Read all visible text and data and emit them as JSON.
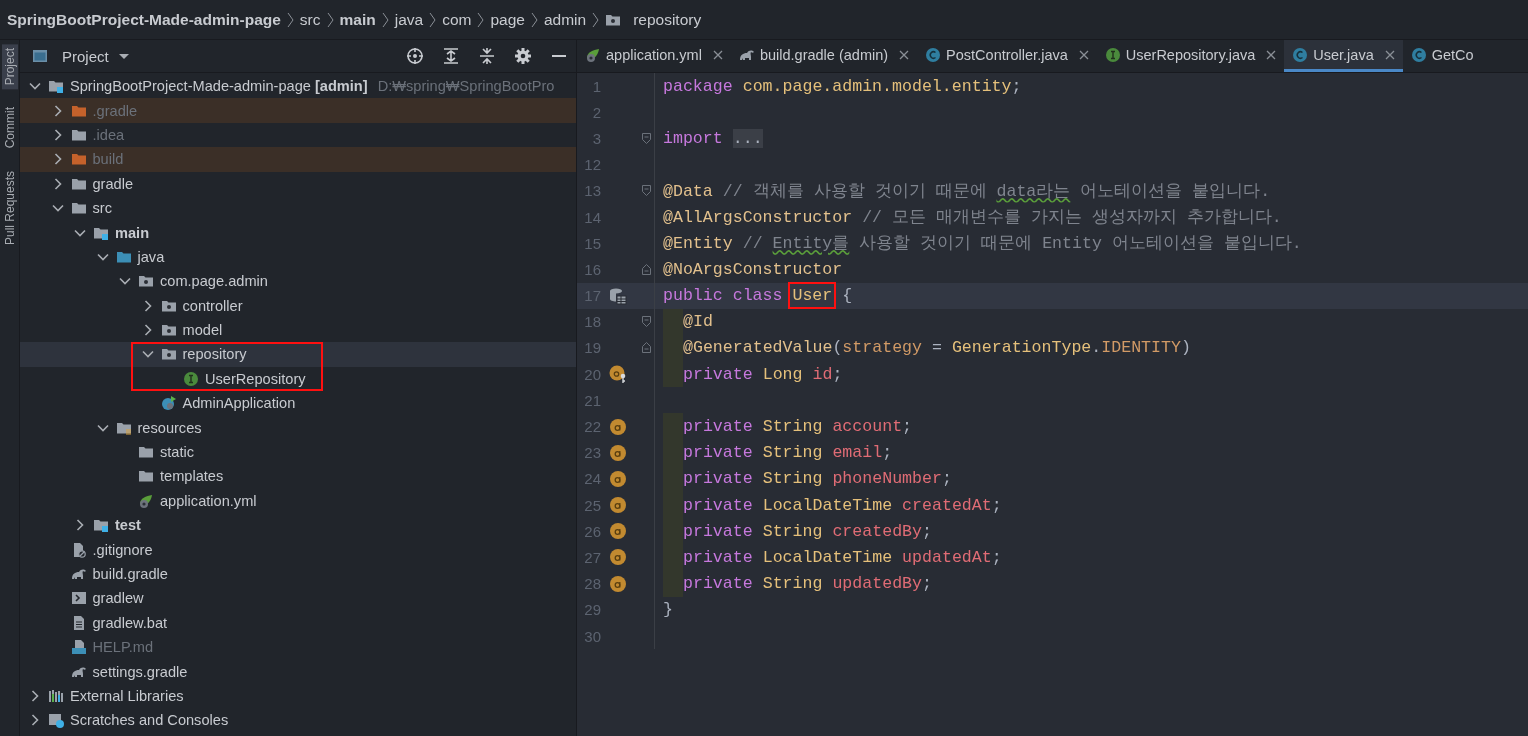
{
  "breadcrumbs": [
    {
      "label": "SpringBootProject-Made-admin-page",
      "kind": "bold"
    },
    {
      "label": "src",
      "kind": "plain"
    },
    {
      "label": "main",
      "kind": "bold"
    },
    {
      "label": "java",
      "kind": "plain"
    },
    {
      "label": "com",
      "kind": "plain"
    },
    {
      "label": "page",
      "kind": "plain"
    },
    {
      "label": "admin",
      "kind": "plain"
    },
    {
      "label": "repository",
      "kind": "folder"
    }
  ],
  "tool_strip": [
    {
      "label": "Project",
      "selected": true
    },
    {
      "label": "Commit",
      "selected": false
    },
    {
      "label": "Pull Requests",
      "selected": false
    }
  ],
  "project_panel": {
    "title": "Project",
    "tree": [
      {
        "label": "SpringBootProject-Made-admin-page",
        "module": "[admin]",
        "path": "D:₩spring₩SpringBootPro",
        "kind": "module",
        "excluded": false,
        "dimmed": false,
        "selected": false,
        "expanded": true,
        "children": [
          {
            "label": ".gradle",
            "kind": "folder-excluded",
            "excluded": true,
            "dimmed": true,
            "selected": false,
            "expanded": false
          },
          {
            "label": ".idea",
            "kind": "folder",
            "excluded": false,
            "dimmed": true,
            "selected": false,
            "expanded": false
          },
          {
            "label": "build",
            "kind": "folder-excluded",
            "excluded": true,
            "dimmed": true,
            "selected": false,
            "expanded": false
          },
          {
            "label": "gradle",
            "kind": "folder",
            "excluded": false,
            "dimmed": false,
            "selected": false,
            "expanded": false
          },
          {
            "label": "src",
            "kind": "folder",
            "excluded": false,
            "dimmed": false,
            "selected": false,
            "expanded": true,
            "children": [
              {
                "label": "main",
                "kind": "source-root",
                "excluded": false,
                "dimmed": false,
                "selected": false,
                "expanded": true,
                "children": [
                  {
                    "label": "java",
                    "kind": "java-root",
                    "excluded": false,
                    "dimmed": false,
                    "selected": false,
                    "expanded": true,
                    "children": [
                      {
                        "label": "com.page.admin",
                        "kind": "package",
                        "excluded": false,
                        "dimmed": false,
                        "selected": false,
                        "expanded": true,
                        "children": [
                          {
                            "label": "controller",
                            "kind": "package",
                            "excluded": false,
                            "dimmed": false,
                            "selected": false,
                            "expanded": false
                          },
                          {
                            "label": "model",
                            "kind": "package",
                            "excluded": false,
                            "dimmed": false,
                            "selected": false,
                            "expanded": false
                          },
                          {
                            "label": "repository",
                            "kind": "package",
                            "excluded": false,
                            "dimmed": false,
                            "selected": true,
                            "boxed": true,
                            "expanded": true,
                            "children": [
                              {
                                "label": "UserRepository",
                                "kind": "interface",
                                "excluded": false,
                                "dimmed": false,
                                "selected": false
                              }
                            ]
                          },
                          {
                            "label": "AdminApplication",
                            "kind": "spring-app",
                            "excluded": false,
                            "dimmed": false,
                            "selected": false
                          }
                        ]
                      }
                    ]
                  },
                  {
                    "label": "resources",
                    "kind": "resources-root",
                    "excluded": false,
                    "dimmed": false,
                    "selected": false,
                    "expanded": true,
                    "children": [
                      {
                        "label": "static",
                        "kind": "folder",
                        "excluded": false,
                        "dimmed": false,
                        "selected": false
                      },
                      {
                        "label": "templates",
                        "kind": "folder",
                        "excluded": false,
                        "dimmed": false,
                        "selected": false
                      },
                      {
                        "label": "application.yml",
                        "kind": "spring-config",
                        "excluded": false,
                        "dimmed": false,
                        "selected": false
                      }
                    ]
                  }
                ]
              },
              {
                "label": "test",
                "kind": "source-root",
                "excluded": false,
                "dimmed": false,
                "selected": false,
                "expanded": false
              }
            ]
          },
          {
            "label": ".gitignore",
            "kind": "gitignore",
            "excluded": false,
            "dimmed": false,
            "selected": false
          },
          {
            "label": "build.gradle",
            "kind": "gradle",
            "excluded": false,
            "dimmed": false,
            "selected": false
          },
          {
            "label": "gradlew",
            "kind": "script",
            "excluded": false,
            "dimmed": false,
            "selected": false
          },
          {
            "label": "gradlew.bat",
            "kind": "text-file",
            "excluded": false,
            "dimmed": false,
            "selected": false
          },
          {
            "label": "HELP.md",
            "kind": "markdown",
            "excluded": false,
            "dimmed": true,
            "selected": false
          },
          {
            "label": "settings.gradle",
            "kind": "gradle",
            "excluded": false,
            "dimmed": false,
            "selected": false
          }
        ]
      },
      {
        "label": "External Libraries",
        "kind": "library",
        "excluded": false,
        "dimmed": false,
        "selected": false,
        "expanded": false
      },
      {
        "label": "Scratches and Consoles",
        "kind": "scratches",
        "excluded": false,
        "dimmed": false,
        "selected": false,
        "expanded": false
      }
    ]
  },
  "editor": {
    "tabs": [
      {
        "label": "application.yml",
        "kind": "spring-config",
        "selected": false,
        "closable": true
      },
      {
        "label": "build.gradle (admin)",
        "kind": "gradle",
        "selected": false,
        "closable": true
      },
      {
        "label": "PostController.java",
        "kind": "class",
        "selected": false,
        "closable": true
      },
      {
        "label": "UserRepository.java",
        "kind": "interface",
        "selected": false,
        "closable": true
      },
      {
        "label": "User.java",
        "kind": "class",
        "selected": true,
        "closable": true
      },
      {
        "label": "GetCo",
        "kind": "class",
        "selected": false,
        "closable": false
      }
    ],
    "lines": [
      {
        "number": "1",
        "tokens": [
          {
            "kind": "keyword",
            "text": "package "
          },
          {
            "kind": "package",
            "text": "com.page.admin.model.entity"
          },
          {
            "kind": "plain",
            "text": ";"
          }
        ]
      },
      {
        "number": "2"
      },
      {
        "number": "3",
        "fold": {
          "kind": "start"
        },
        "tokens": [
          {
            "kind": "keyword",
            "text": "import "
          },
          {
            "kind": "folded",
            "text": "..."
          }
        ]
      },
      {
        "number": "12"
      },
      {
        "number": "13",
        "fold": {
          "kind": "start"
        },
        "tokens": [
          {
            "kind": "annotation",
            "text": "@Data"
          },
          {
            "kind": "comment",
            "text": " // 객체를 사용할 것이기 때문에 "
          },
          {
            "kind": "typo",
            "text": "data라는"
          },
          {
            "kind": "comment",
            "text": " 어노테이션을 붙입니다."
          }
        ]
      },
      {
        "number": "14",
        "tokens": [
          {
            "kind": "annotation",
            "text": "@AllArgsConstructor"
          },
          {
            "kind": "comment",
            "text": " // 모든 매개변수를 가지는 생성자까지 추가합니다."
          }
        ]
      },
      {
        "number": "15",
        "tokens": [
          {
            "kind": "annotation",
            "text": "@Entity"
          },
          {
            "kind": "comment",
            "text": " // "
          },
          {
            "kind": "typo",
            "text": "Entity를"
          },
          {
            "kind": "comment",
            "text": " 사용할 것이기 때문에 Entity 어노테이션을 붙입니다."
          }
        ]
      },
      {
        "number": "16",
        "fold": {
          "kind": "end"
        },
        "tokens": [
          {
            "kind": "annotation",
            "text": "@NoArgsConstructor"
          }
        ]
      },
      {
        "number": "17",
        "gutter": {
          "kind": "entity"
        },
        "current": true,
        "tokens": [
          {
            "kind": "keyword",
            "text": "public class "
          },
          {
            "kind": "type",
            "text": "User",
            "boxed": true
          },
          {
            "kind": "plain",
            "text": " {"
          }
        ]
      },
      {
        "number": "18",
        "fold": {
          "kind": "start"
        },
        "indent": true,
        "tokens": [
          {
            "kind": "annotation",
            "text": "@Id"
          }
        ]
      },
      {
        "number": "19",
        "fold": {
          "kind": "end"
        },
        "indent": true,
        "tokens": [
          {
            "kind": "annotation",
            "text": "@GeneratedValue"
          },
          {
            "kind": "plain",
            "text": "("
          },
          {
            "kind": "param",
            "text": "strategy"
          },
          {
            "kind": "plain",
            "text": " = "
          },
          {
            "kind": "type",
            "text": "GenerationType"
          },
          {
            "kind": "plain",
            "text": "."
          },
          {
            "kind": "constant",
            "text": "IDENTITY"
          },
          {
            "kind": "plain",
            "text": ")"
          }
        ]
      },
      {
        "number": "20",
        "gutter": {
          "kind": "id-field"
        },
        "indent": true,
        "tokens": [
          {
            "kind": "keyword",
            "text": "private "
          },
          {
            "kind": "type",
            "text": "Long "
          },
          {
            "kind": "field",
            "text": "id"
          },
          {
            "kind": "plain",
            "text": ";"
          }
        ]
      },
      {
        "number": "21"
      },
      {
        "number": "22",
        "gutter": {
          "kind": "field"
        },
        "indent": true,
        "tokens": [
          {
            "kind": "keyword",
            "text": "private "
          },
          {
            "kind": "type",
            "text": "String "
          },
          {
            "kind": "field",
            "text": "account"
          },
          {
            "kind": "plain",
            "text": ";"
          }
        ]
      },
      {
        "number": "23",
        "gutter": {
          "kind": "field"
        },
        "indent": true,
        "tokens": [
          {
            "kind": "keyword",
            "text": "private "
          },
          {
            "kind": "type",
            "text": "String "
          },
          {
            "kind": "field",
            "text": "email"
          },
          {
            "kind": "plain",
            "text": ";"
          }
        ]
      },
      {
        "number": "24",
        "gutter": {
          "kind": "field"
        },
        "indent": true,
        "tokens": [
          {
            "kind": "keyword",
            "text": "private "
          },
          {
            "kind": "type",
            "text": "String "
          },
          {
            "kind": "field",
            "text": "phoneNumber"
          },
          {
            "kind": "plain",
            "text": ";"
          }
        ]
      },
      {
        "number": "25",
        "gutter": {
          "kind": "field"
        },
        "indent": true,
        "tokens": [
          {
            "kind": "keyword",
            "text": "private "
          },
          {
            "kind": "type",
            "text": "LocalDateTime "
          },
          {
            "kind": "field",
            "text": "createdAt"
          },
          {
            "kind": "plain",
            "text": ";"
          }
        ]
      },
      {
        "number": "26",
        "gutter": {
          "kind": "field"
        },
        "indent": true,
        "tokens": [
          {
            "kind": "keyword",
            "text": "private "
          },
          {
            "kind": "type",
            "text": "String "
          },
          {
            "kind": "field",
            "text": "createdBy"
          },
          {
            "kind": "plain",
            "text": ";"
          }
        ]
      },
      {
        "number": "27",
        "gutter": {
          "kind": "field"
        },
        "indent": true,
        "tokens": [
          {
            "kind": "keyword",
            "text": "private "
          },
          {
            "kind": "type",
            "text": "LocalDateTime "
          },
          {
            "kind": "field",
            "text": "updatedAt"
          },
          {
            "kind": "plain",
            "text": ";"
          }
        ]
      },
      {
        "number": "28",
        "gutter": {
          "kind": "field"
        },
        "indent": true,
        "tokens": [
          {
            "kind": "keyword",
            "text": "private "
          },
          {
            "kind": "type",
            "text": "String "
          },
          {
            "kind": "field",
            "text": "updatedBy"
          },
          {
            "kind": "plain",
            "text": ";"
          }
        ]
      },
      {
        "number": "29",
        "tokens": [
          {
            "kind": "plain",
            "text": "}"
          }
        ]
      },
      {
        "number": "30"
      }
    ]
  }
}
